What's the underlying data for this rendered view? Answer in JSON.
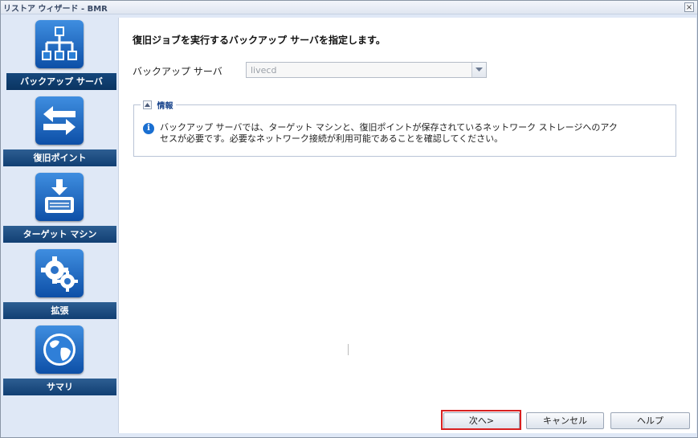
{
  "window": {
    "title": "リストア ウィザード - BMR",
    "close_label": "×"
  },
  "sidebar": {
    "items": [
      {
        "label": "バックアップ サーバ",
        "icon": "network-server-icon",
        "active": true
      },
      {
        "label": "復旧ポイント",
        "icon": "exchange-arrows-icon"
      },
      {
        "label": "ターゲット マシン",
        "icon": "disk-download-icon"
      },
      {
        "label": "拡張",
        "icon": "gears-icon"
      },
      {
        "label": "サマリ",
        "icon": "globe-icon"
      }
    ]
  },
  "main": {
    "heading": "復旧ジョブを実行するバックアップ サーバを指定します。",
    "backup_server_label": "バックアップ サーバ",
    "backup_server_value": "livecd",
    "info": {
      "title": "情報",
      "text": "バックアップ サーバでは、ターゲット マシンと、復旧ポイントが保存されているネットワーク ストレージへのアクセスが必要です。必要なネットワーク接続が利用可能であることを確認してください。"
    }
  },
  "buttons": {
    "next": "次へ>",
    "cancel": "キャンセル",
    "help": "ヘルプ"
  },
  "colors": {
    "sidebar_label": "#1a4a80",
    "highlight": "#d82020",
    "info_icon": "#1a6fd1"
  }
}
